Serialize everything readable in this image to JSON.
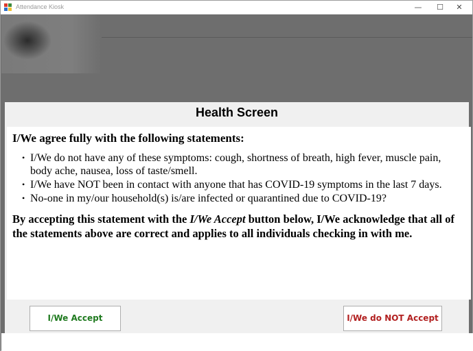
{
  "window": {
    "title": "Attendance Kiosk",
    "controls": {
      "minimize": "—",
      "maximize": "☐",
      "close": "✕"
    }
  },
  "dialog": {
    "title": "Health Screen",
    "intro": "I/We agree fully with the following statements:",
    "statements": [
      "I/We do not have any of these symptoms: cough, shortness of breath, high fever, muscle pain, body ache, nausea, loss of taste/smell.",
      "I/We have NOT been in contact with anyone that has COVID-19 symptoms in the last 7 days.",
      "No-one in my/our household(s) is/are infected or quarantined due to COVID-19?"
    ],
    "bullet": "•",
    "acknowledgement": {
      "before": "By accepting this statement with the ",
      "emphasis": "I/We Accept",
      "after": " button below, I/We acknowledge that all of the statements above are correct and applies to all individuals checking in with me."
    },
    "buttons": {
      "accept": "I/We Accept",
      "decline": "I/We do NOT Accept"
    }
  },
  "colors": {
    "accept_text": "#1f7a1f",
    "decline_text": "#b22020",
    "overlay": "#6e6e6e",
    "dialog_bg": "#f0f0f0"
  },
  "icons": {
    "app": "windows-forms-app-icon"
  }
}
